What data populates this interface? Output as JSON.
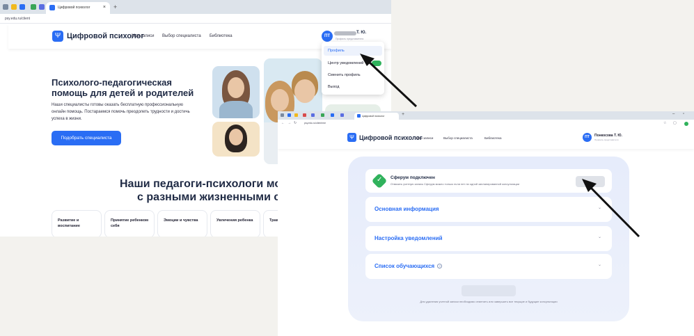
{
  "screen1": {
    "tab_title": "Цифровой психолог",
    "url": "psy.edu.ru/client",
    "brand": "Цифровой психолог",
    "nav": [
      "Мои записи",
      "Выбор специалиста",
      "Библиотека"
    ],
    "avatar_initials": "ПТ",
    "user_name_suffix": "Т. Ю.",
    "user_role": "Профиль представителя",
    "hero_title": "Психолого-педагогическая помощь для детей и родителей",
    "hero_text": "Наши специалисты готовы оказать бесплатную профессиональную онлайн помощь. Постараемся помочь преодолеть трудности и достичь успеха в жизни.",
    "hero_button": "Подобрать специалиста",
    "menu": [
      "Профиль",
      "Центр уведомлений",
      "Сменить профиль",
      "Выход"
    ],
    "section_title_line1": "Наши педагоги-психологи могут п",
    "section_title_line2": "с разными жизненными ситуаци",
    "cards": [
      "Развитие и воспитание",
      "Принятие ребенком себя",
      "Эмоции и чувства",
      "Увлечения ребенка",
      "Трав"
    ]
  },
  "screen2": {
    "tab_title": "Цифровой психолог",
    "url": "psy.edu.ru/client/me",
    "brand": "Цифровой психолог",
    "nav": [
      "Мои записи",
      "Выбор специалиста",
      "Библиотека"
    ],
    "avatar_initials": "ПТ",
    "user_name": "Понкосова Т. Ю.",
    "user_role": "Профиль представителя",
    "sferum_title": "Сферум подключен",
    "sferum_sub": "Отвязать учетную запись Сферум можно только если нет ни одной запланированной консультации",
    "sections": [
      "Основная информация",
      "Настройка уведомлений",
      "Список обучающихся"
    ],
    "footer_note": "Для удаления учетной записи необходимо отменить или завершить все текущие и будущие консультации"
  },
  "colors": {
    "accent": "#2a6df4",
    "success": "#30b25c",
    "text": "#1f2a44"
  }
}
